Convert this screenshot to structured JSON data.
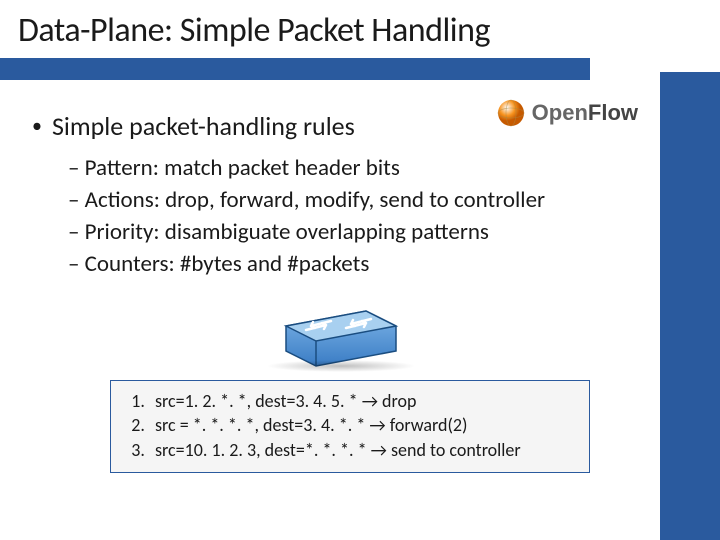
{
  "title": "Data-Plane: Simple Packet Handling",
  "logo": {
    "open": "Open",
    "flow": "Flow"
  },
  "main_bullet": "Simple packet-handling rules",
  "sub_bullets": [
    "Pattern: match packet header bits",
    "Actions: drop, forward, modify, send to controller",
    "Priority: disambiguate overlapping patterns",
    "Counters: #bytes and #packets"
  ],
  "rules": [
    "src=1. 2. *. *, dest=3. 4. 5. * → drop",
    "src = *. *. *. *, dest=3. 4. *. * → forward(2)",
    "src=10. 1. 2. 3, dest=*. *. *. * → send to controller"
  ],
  "icons": {
    "switch": "network-switch-icon",
    "globe": "globe-icon"
  }
}
